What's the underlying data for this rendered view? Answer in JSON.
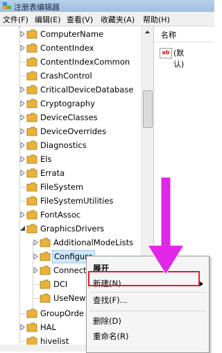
{
  "window": {
    "title": "注册表编辑器"
  },
  "menubar": [
    "文件(F)",
    "编辑(E)",
    "查看(V)",
    "收藏夹(A)",
    "帮助(H)"
  ],
  "tree": {
    "items": [
      {
        "label": "ComputerName",
        "expandable": true
      },
      {
        "label": "ContentIndex",
        "expandable": true
      },
      {
        "label": "ContentIndexCommon",
        "expandable": false
      },
      {
        "label": "CrashControl",
        "expandable": false
      },
      {
        "label": "CriticalDeviceDatabase",
        "expandable": true
      },
      {
        "label": "Cryptography",
        "expandable": true
      },
      {
        "label": "DeviceClasses",
        "expandable": true
      },
      {
        "label": "DeviceOverrides",
        "expandable": true
      },
      {
        "label": "Diagnostics",
        "expandable": true
      },
      {
        "label": "Els",
        "expandable": true
      },
      {
        "label": "Errata",
        "expandable": true
      },
      {
        "label": "FileSystem",
        "expandable": false
      },
      {
        "label": "FileSystemUtilities",
        "expandable": false
      },
      {
        "label": "FontAssoc",
        "expandable": true
      },
      {
        "label": "GraphicsDrivers",
        "expandable": true,
        "expanded": true
      },
      {
        "label": "AdditionalModeLists",
        "expandable": true,
        "child": true
      },
      {
        "label": "Configura",
        "expandable": true,
        "child": true,
        "selected": true
      },
      {
        "label": "Connect",
        "expandable": true,
        "child": true
      },
      {
        "label": "DCI",
        "expandable": false,
        "child": true
      },
      {
        "label": "UseNew",
        "expandable": false,
        "child": true
      },
      {
        "label": "GroupOrde",
        "expandable": false
      },
      {
        "label": "HAL",
        "expandable": true
      },
      {
        "label": "hivelist",
        "expandable": false
      }
    ]
  },
  "right_pane": {
    "column_header": "名称",
    "values": [
      {
        "icon": "ab",
        "name": "(默认)"
      }
    ]
  },
  "context_menu": {
    "items": [
      {
        "label": "展开",
        "bold": true
      },
      {
        "label": "新建(N)",
        "submenu": true
      },
      {
        "label": "查找(F)...",
        "highlighted": true
      },
      {
        "label": "删除(D)"
      },
      {
        "label": "重命名(R)"
      }
    ]
  },
  "colors": {
    "highlight_box": "#e11d2b",
    "arrow": "#e026e6",
    "folder": "#e8b33a"
  }
}
